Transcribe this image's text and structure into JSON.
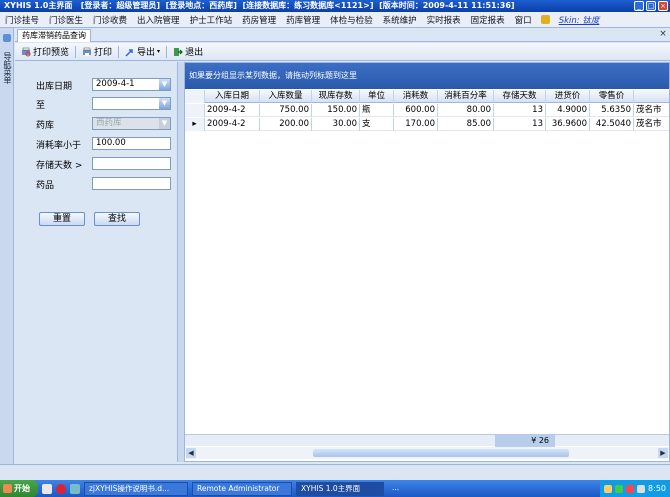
{
  "window": {
    "title": "XYHIS 1.0主界面",
    "login_user": "[登录者：超级管理员]",
    "login_location": "[登录地点：西药库]",
    "connection": "[连接数据库：练习数据库<1121>]",
    "version_time": "[版本时间：2009-4-11 11:51:36]",
    "buttons": [
      "_",
      "□",
      "×"
    ]
  },
  "menu": {
    "items": [
      "门诊挂号",
      "门诊医生",
      "门诊收费",
      "出入院管理",
      "护士工作站",
      "药房管理",
      "药库管理",
      "体检与检验",
      "系统维护",
      "实时报表",
      "固定报表",
      "窗口"
    ],
    "skin_label": "Skin: 钛度"
  },
  "leftstrip": {
    "label": "导航菜单"
  },
  "tab": {
    "label": "药库滞销药品查询",
    "close": "×"
  },
  "toolbar": {
    "print_preview": "打印预览",
    "print": "打印",
    "export": "导出",
    "exit": "退出"
  },
  "filters": {
    "in_date_label": "出库日期",
    "in_date_value": "2009-4-1",
    "to_label": "至",
    "to_value": "",
    "warehouse_label": "药库",
    "warehouse_value": "西药库",
    "consume_rate_label": "消耗率小于",
    "consume_rate_value": "100.00",
    "storage_days_label": "存储天数 >",
    "storage_days_value": "",
    "drug_label": "药品",
    "drug_value": "",
    "reset_button": "重置",
    "search_button": "查找"
  },
  "grid": {
    "group_hint": "如果要分组显示某列数据，请拖动列标题到这里",
    "columns": [
      "入库日期",
      "入库数量",
      "现库存数",
      "单位",
      "消耗数",
      "消耗百分率",
      "存储天数",
      "进货价",
      "零售价",
      ""
    ],
    "rows": [
      {
        "indicator": "",
        "cells": [
          "2009-4-2",
          "750.00",
          "150.00",
          "瓶",
          "600.00",
          "80.00",
          "13",
          "4.9000",
          "5.6350",
          "茂名市"
        ]
      },
      {
        "indicator": "▸",
        "cells": [
          "2009-4-2",
          "200.00",
          "30.00",
          "支",
          "170.00",
          "85.00",
          "13",
          "36.9600",
          "42.5040",
          "茂名市"
        ]
      }
    ],
    "footer_sum": "¥ 26"
  },
  "taskbar": {
    "start": "开始",
    "tasks": [
      "zjXYHIS操作说明书.d...",
      "Remote Administrator",
      "XYHIS 1.0主界面",
      "..."
    ],
    "clock": "8:50"
  }
}
